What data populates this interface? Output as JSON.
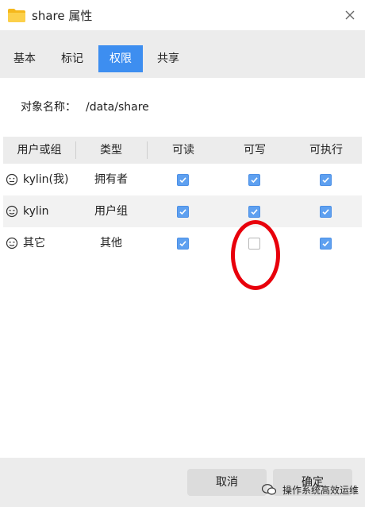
{
  "window": {
    "title": "share 属性"
  },
  "tabs": [
    {
      "label": "基本"
    },
    {
      "label": "标记"
    },
    {
      "label": "权限",
      "active": true
    },
    {
      "label": "共享"
    }
  ],
  "object": {
    "label": "对象名称：",
    "value": "/data/share"
  },
  "table": {
    "headers": [
      "用户或组",
      "类型",
      "可读",
      "可写",
      "可执行"
    ],
    "rows": [
      {
        "name": "kylin(我)",
        "type": "拥有者",
        "read": true,
        "write": true,
        "execute": true
      },
      {
        "name": "kylin",
        "type": "用户组",
        "read": true,
        "write": true,
        "execute": true
      },
      {
        "name": "其它",
        "type": "其他",
        "read": true,
        "write": false,
        "execute": true
      }
    ]
  },
  "buttons": {
    "cancel": "取消",
    "ok": "确定"
  },
  "watermark": "操作系统高效运维",
  "colors": {
    "accent": "#3d8ef0",
    "checkbox": "#5ea0f0",
    "annotation": "#e8000b"
  }
}
